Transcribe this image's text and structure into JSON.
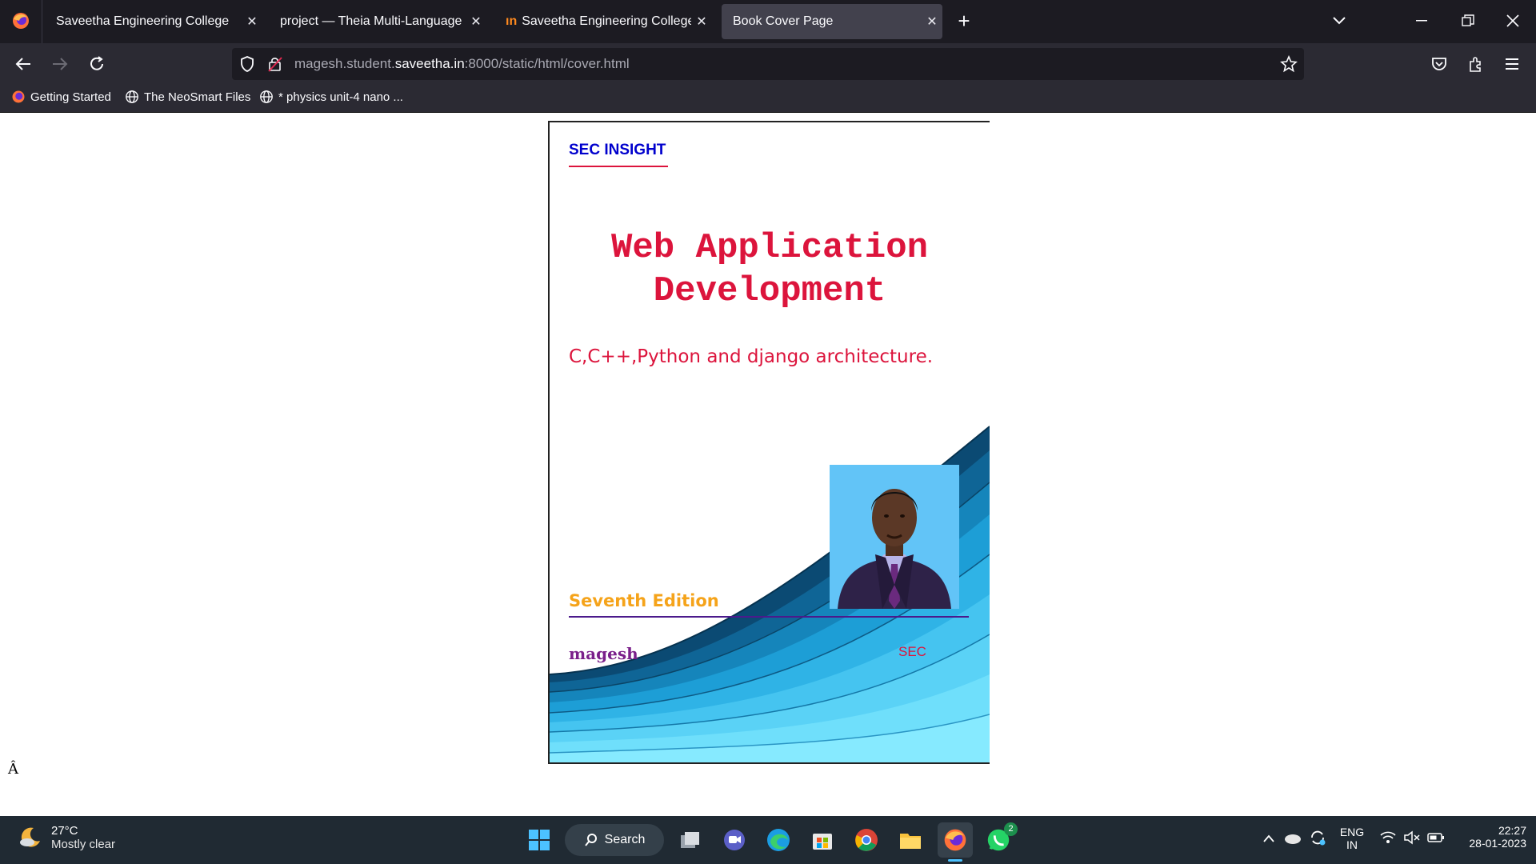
{
  "browser": {
    "tabs": [
      {
        "title": "Saveetha Engineering College",
        "close": "✕"
      },
      {
        "title": "project — Theia Multi-Language Ex",
        "close": "✕"
      },
      {
        "title": "Saveetha Engineering College",
        "close": "✕"
      },
      {
        "title": "Book Cover Page",
        "close": "✕",
        "active": true
      }
    ],
    "new_tab": "+",
    "url": {
      "prefix": "magesh.student.",
      "host": "saveetha.in",
      "suffix": ":8000/static/html/cover.html"
    },
    "bookmarks": [
      "Getting Started",
      "The NeoSmart Files",
      "* physics unit-4 nano ..."
    ]
  },
  "cover": {
    "brand": "SEC INSIGHT",
    "title_line1": "Web Application",
    "title_line2": "Development",
    "subtitle": "C,C++,Python and django architecture.",
    "edition": "Seventh Edition",
    "author": "magesh",
    "publisher": "SEC"
  },
  "page": {
    "stray_char": "Â"
  },
  "taskbar": {
    "weather_temp": "27°C",
    "weather_cond": "Mostly clear",
    "search_label": "Search",
    "whatsapp_badge": "2",
    "lang_top": "ENG",
    "lang_bottom": "IN",
    "time": "22:27",
    "date": "28-01-2023"
  },
  "colors": {
    "brand": "#0000cd",
    "title": "#dc143c",
    "edition": "#f5a31a",
    "author": "#7a1f8a",
    "wave_dark": "#0a4f7a",
    "wave_light": "#7fe8ff"
  }
}
